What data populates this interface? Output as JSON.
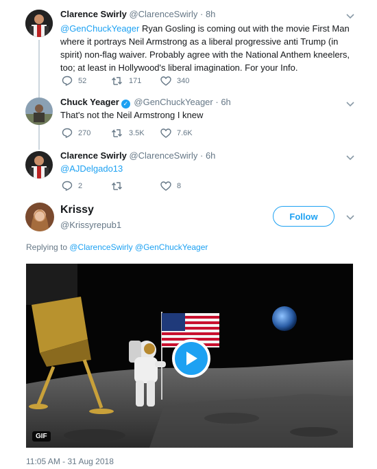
{
  "colors": {
    "accent": "#1da1f2",
    "secondary_text": "#657786",
    "primary_text": "#14171a"
  },
  "tweets": [
    {
      "name": "Clarence Swirly",
      "handle": "@ClarenceSwirly",
      "dot": "·",
      "time": "8h",
      "mention": "@GenChuckYeager",
      "text": " Ryan Gosling is coming out with the movie First Man where it portrays Neil Armstrong as a liberal progressive anti Trump (in spirit) non-flag waiver. Probably agree with the National Anthem kneelers, too; at least in Hollywood's liberal imagination. For your Info.",
      "replies": "52",
      "retweets": "171",
      "likes": "340"
    },
    {
      "name": "Chuck Yeager",
      "verified": "✓",
      "handle": "@GenChuckYeager",
      "dot": "·",
      "time": "6h",
      "text": "That's not the Neil Armstrong I knew",
      "replies": "270",
      "retweets": "3.5K",
      "likes": "7.6K"
    },
    {
      "name": "Clarence Swirly",
      "handle": "@ClarenceSwirly",
      "dot": "·",
      "time": "6h",
      "mention": "@AJDelgado13",
      "replies": "2",
      "likes": "8"
    }
  ],
  "main_tweet": {
    "name": "Krissy",
    "handle": "@Krissyrepub1",
    "follow_label": "Follow",
    "replying_prefix": "Replying to ",
    "replying_to": "@ClarenceSwirly @GenChuckYeager",
    "media_badge": "GIF",
    "timestamp": "11:05 AM - 31 Aug 2018"
  },
  "icons": [
    "reply-icon",
    "retweet-icon",
    "like-icon",
    "chevron-down-icon",
    "verified-icon",
    "play-icon"
  ]
}
